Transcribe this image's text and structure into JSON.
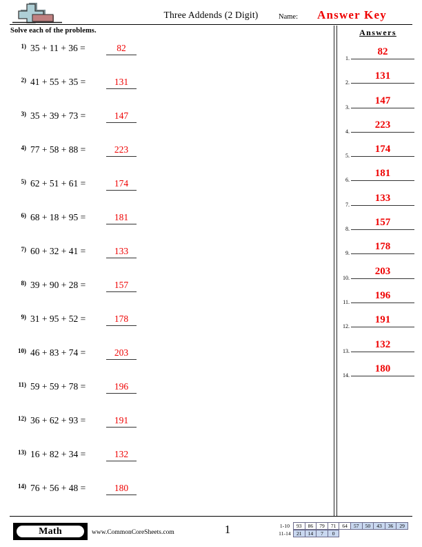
{
  "header": {
    "title": "Three Addends (2 Digit)",
    "name_label": "Name:",
    "answer_key": "Answer Key",
    "logo_icon": "plus-block-logo"
  },
  "instructions": "Solve each of the problems.",
  "problems": [
    {
      "number": "1)",
      "expression": "35 + 11 + 36 =",
      "answer": "82"
    },
    {
      "number": "2)",
      "expression": "41 + 55 + 35 =",
      "answer": "131"
    },
    {
      "number": "3)",
      "expression": "35 + 39 + 73 =",
      "answer": "147"
    },
    {
      "number": "4)",
      "expression": "77 + 58 + 88 =",
      "answer": "223"
    },
    {
      "number": "5)",
      "expression": "62 + 51 + 61 =",
      "answer": "174"
    },
    {
      "number": "6)",
      "expression": "68 + 18 + 95 =",
      "answer": "181"
    },
    {
      "number": "7)",
      "expression": "60 + 32 + 41 =",
      "answer": "133"
    },
    {
      "number": "8)",
      "expression": "39 + 90 + 28 =",
      "answer": "157"
    },
    {
      "number": "9)",
      "expression": "31 + 95 + 52 =",
      "answer": "178"
    },
    {
      "number": "10)",
      "expression": "46 + 83 + 74 =",
      "answer": "203"
    },
    {
      "number": "11)",
      "expression": "59 + 59 + 78 =",
      "answer": "196"
    },
    {
      "number": "12)",
      "expression": "36 + 62 + 93 =",
      "answer": "191"
    },
    {
      "number": "13)",
      "expression": "16 + 82 + 34 =",
      "answer": "132"
    },
    {
      "number": "14)",
      "expression": "76 + 56 + 48 =",
      "answer": "180"
    }
  ],
  "answers_panel": {
    "title": "Answers",
    "rows": [
      {
        "number": "1.",
        "value": "82"
      },
      {
        "number": "2.",
        "value": "131"
      },
      {
        "number": "3.",
        "value": "147"
      },
      {
        "number": "4.",
        "value": "223"
      },
      {
        "number": "5.",
        "value": "174"
      },
      {
        "number": "6.",
        "value": "181"
      },
      {
        "number": "7.",
        "value": "133"
      },
      {
        "number": "8.",
        "value": "157"
      },
      {
        "number": "9.",
        "value": "178"
      },
      {
        "number": "10.",
        "value": "203"
      },
      {
        "number": "11.",
        "value": "196"
      },
      {
        "number": "12.",
        "value": "191"
      },
      {
        "number": "13.",
        "value": "132"
      },
      {
        "number": "14.",
        "value": "180"
      }
    ]
  },
  "footer": {
    "subject_badge": "Math",
    "site_url": "www.CommonCoreSheets.com",
    "page_number": "1"
  },
  "score_table": {
    "rows": [
      {
        "label": "1-10",
        "cells": [
          {
            "value": "93",
            "highlight": false
          },
          {
            "value": "86",
            "highlight": false
          },
          {
            "value": "79",
            "highlight": false
          },
          {
            "value": "71",
            "highlight": false
          },
          {
            "value": "64",
            "highlight": false
          },
          {
            "value": "57",
            "highlight": true
          },
          {
            "value": "50",
            "highlight": true
          },
          {
            "value": "43",
            "highlight": true
          },
          {
            "value": "36",
            "highlight": true
          },
          {
            "value": "29",
            "highlight": true
          }
        ]
      },
      {
        "label": "11-14",
        "cells": [
          {
            "value": "21",
            "highlight": true
          },
          {
            "value": "14",
            "highlight": true
          },
          {
            "value": "7",
            "highlight": true
          },
          {
            "value": "0",
            "highlight": true
          }
        ]
      }
    ]
  },
  "colors": {
    "answer_red": "#ee0000",
    "score_highlight": "#c9d8f0",
    "logo_plus": "#aecfd6",
    "logo_block": "#c08080"
  }
}
